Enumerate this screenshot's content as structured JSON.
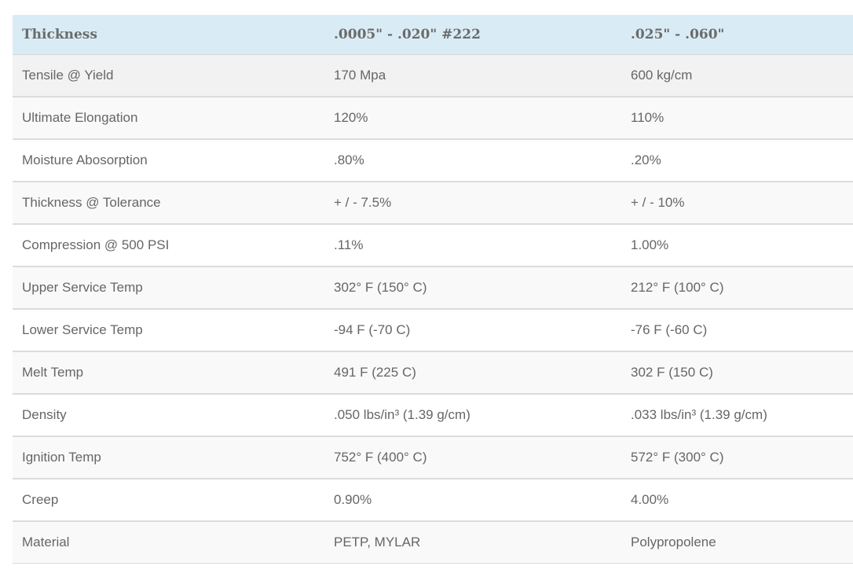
{
  "table": {
    "headers": [
      "Thickness",
      ".0005\" - .020\" #222",
      ".025\" - .060\""
    ],
    "rows": [
      [
        "Tensile @ Yield",
        "170 Mpa",
        "600 kg/cm"
      ],
      [
        "Ultimate Elongation",
        "120%",
        "110%"
      ],
      [
        "Moisture Abosorption",
        ".80%",
        ".20%"
      ],
      [
        "Thickness @ Tolerance",
        "+ / - 7.5%",
        "+ / - 10%"
      ],
      [
        "Compression @ 500 PSI",
        ".11%",
        "1.00%"
      ],
      [
        "Upper Service Temp",
        "302° F (150° C)",
        "212° F (100° C)"
      ],
      [
        "Lower Service Temp",
        "-94 F (-70 C)",
        "-76 F (-60 C)"
      ],
      [
        "Melt Temp",
        "491 F (225 C)",
        "302 F (150 C)"
      ],
      [
        "Density",
        ".050 lbs/in³ (1.39 g/cm)",
        ".033 lbs/in³ (1.39 g/cm)"
      ],
      [
        "Ignition Temp",
        "752° F (400° C)",
        "572° F (300° C)"
      ],
      [
        "Creep",
        "0.90%",
        "4.00%"
      ],
      [
        "Material",
        "PETP, MYLAR",
        "Polypropolene"
      ]
    ]
  },
  "colors": {
    "header_bg": "#d9ecf5",
    "text": "#666666",
    "stripe": "#f9f9f9"
  }
}
